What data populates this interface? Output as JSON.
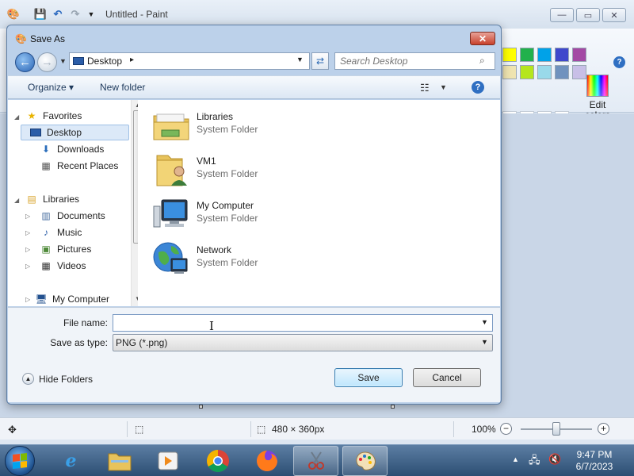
{
  "paint": {
    "title": "Untitled - Paint",
    "window_buttons": {
      "minimize": "—",
      "maximize": "▭",
      "close": "✕"
    },
    "help": "?",
    "edit_colors_label": "Edit colors",
    "palette_row1": [
      "#ffff00",
      "#22b14c",
      "#00a2e8",
      "#3f48cc",
      "#a349a4"
    ],
    "palette_row2": [
      "#efe4b0",
      "#b5e61d",
      "#99d9ea",
      "#7092be",
      "#c8bfe7"
    ],
    "status": {
      "canvas_size": "480 × 360px",
      "zoom": "100%",
      "zoom_fraction": 0.5
    }
  },
  "dialog": {
    "title": "Save As",
    "close": "✕",
    "address": {
      "location": "Desktop",
      "chevron": "▸",
      "dropdown": "▼"
    },
    "search": {
      "placeholder": "Search Desktop",
      "icon": "search-icon"
    },
    "commands": {
      "organize": "Organize ▾",
      "new_folder": "New folder",
      "help": "?"
    },
    "nav": {
      "favorites": {
        "label": "Favorites",
        "items": [
          {
            "label": "Desktop",
            "icon": "desktop-icon",
            "selected": true
          },
          {
            "label": "Downloads",
            "icon": "downloads-icon"
          },
          {
            "label": "Recent Places",
            "icon": "recent-places-icon"
          }
        ]
      },
      "libraries": {
        "label": "Libraries",
        "items": [
          {
            "label": "Documents",
            "icon": "documents-icon"
          },
          {
            "label": "Music",
            "icon": "music-icon"
          },
          {
            "label": "Pictures",
            "icon": "pictures-icon"
          },
          {
            "label": "Videos",
            "icon": "videos-icon"
          }
        ]
      },
      "computer": {
        "label": "My Computer"
      }
    },
    "files": [
      {
        "name": "Libraries",
        "type": "System Folder",
        "icon": "libraries-folder-icon"
      },
      {
        "name": "VM1",
        "type": "System Folder",
        "icon": "user-folder-icon"
      },
      {
        "name": "My Computer",
        "type": "System Folder",
        "icon": "computer-icon"
      },
      {
        "name": "Network",
        "type": "System Folder",
        "icon": "network-icon"
      }
    ],
    "file_name": {
      "label": "File name:",
      "value": ""
    },
    "save_as_type": {
      "label": "Save as type:",
      "value": "PNG (*.png)"
    },
    "hide_folders": "Hide Folders",
    "save_button": "Save",
    "cancel_button": "Cancel"
  },
  "taskbar": {
    "items": [
      "windows-explorer",
      "internet-explorer",
      "file-explorer",
      "media-player",
      "chrome",
      "firefox",
      "snipping-tool",
      "paint"
    ],
    "clock": {
      "time": "9:47 PM",
      "date": "6/7/2023"
    }
  }
}
